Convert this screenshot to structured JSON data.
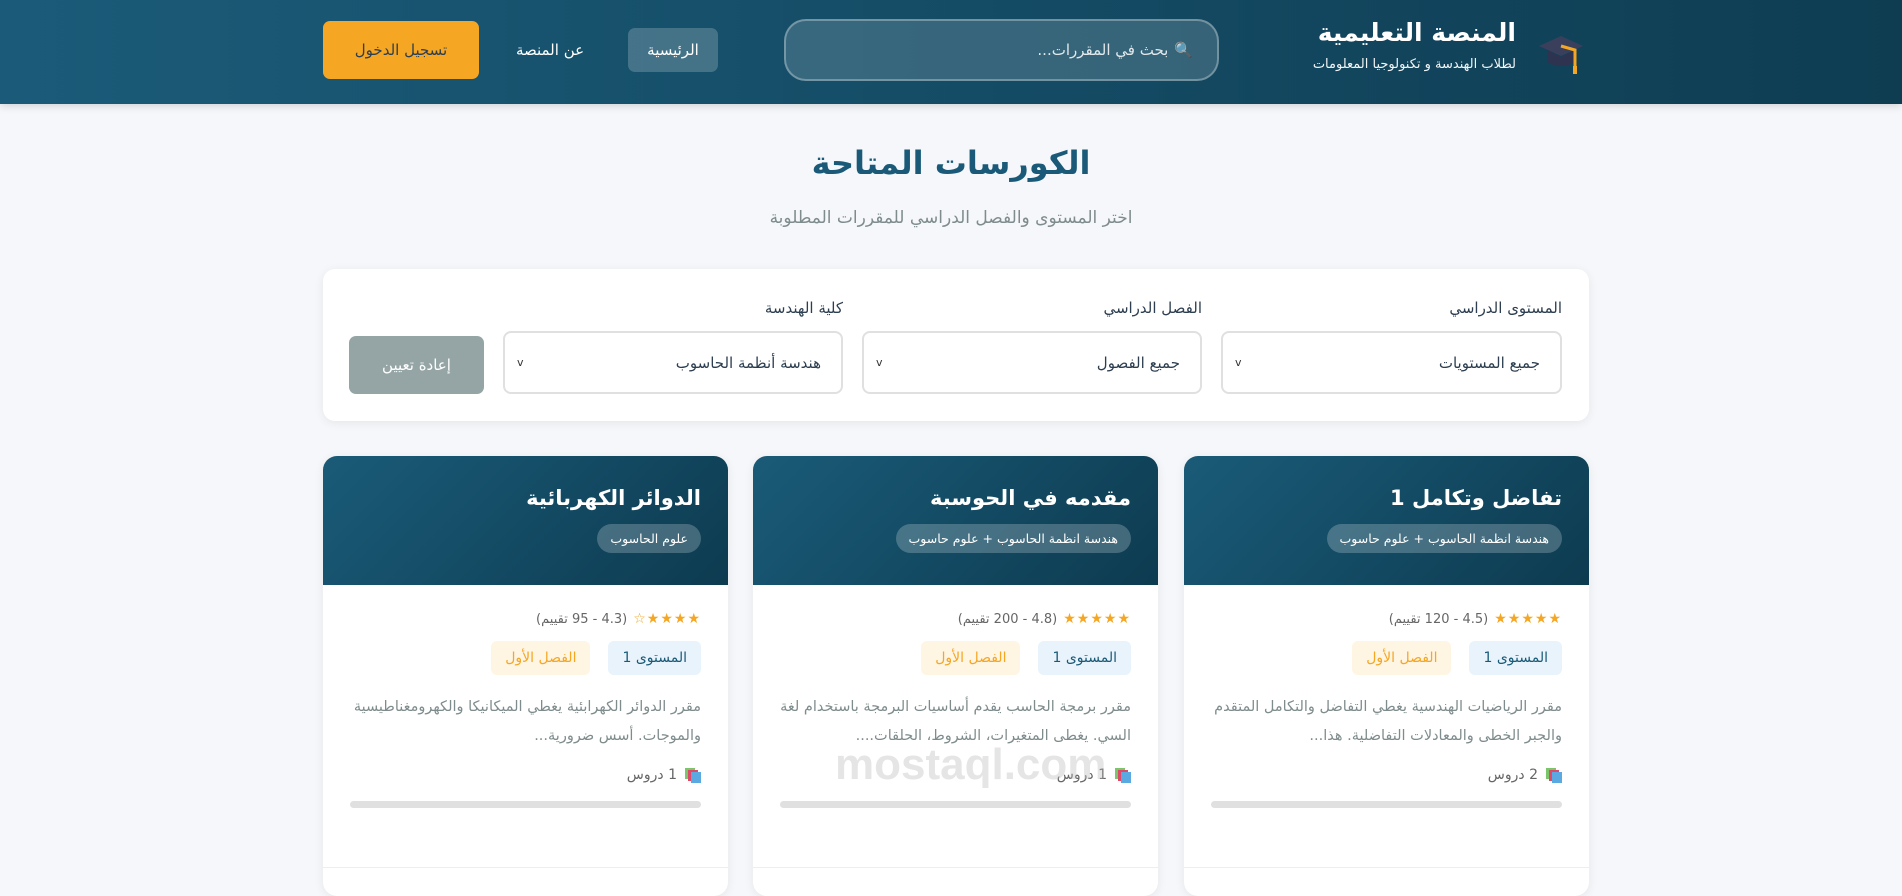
{
  "header": {
    "title": "المنصة التعليمية",
    "subtitle": "لطلاب الهندسة و تكنولوجيا المعلومات",
    "search_placeholder": "بحث في المقررات...",
    "nav": {
      "home": "الرئيسية",
      "about": "عن المنصة",
      "login": "تسجيل الدخول"
    }
  },
  "page": {
    "title": "الكورسات المتاحة",
    "subtitle": "اختر المستوى والفصل الدراسي للمقررات المطلوبة"
  },
  "filters": {
    "level_label": "المستوى الدراسي",
    "level_value": "جميع المستويات",
    "semester_label": "الفصل الدراسي",
    "semester_value": "جميع الفصول",
    "college_label": "كلية الهندسة",
    "college_value": "هندسة أنظمة الحاسوب",
    "reset": "إعادة تعيين"
  },
  "courses": [
    {
      "title": "تفاضل وتكامل 1",
      "tag": "هندسة انظمة الحاسوب + علوم حاسوب",
      "stars": "★★★★★",
      "rating": "(4.5 - 120 تقييم)",
      "level": "المستوى 1",
      "semester": "الفصل الأول",
      "description": "مقرر الرياضيات الهندسية يغطي التفاضل والتكامل المتقدم والجبر الخطى والمعادلات التفاضلية. هذا...",
      "lessons": "2 دروس",
      "progress": 0
    },
    {
      "title": "مقدمه في الحوسبة",
      "tag": "هندسة انظمة الحاسوب + علوم حاسوب",
      "stars": "★★★★★",
      "rating": "(4.8 - 200 تقييم)",
      "level": "المستوى 1",
      "semester": "الفصل الأول",
      "description": "مقرر برمجة الحاسب يقدم أساسيات البرمجة باستخدام لغة السي. يغطى المتغيرات، الشروط، الحلقات....",
      "lessons": "1 دروس",
      "progress": 0
    },
    {
      "title": "الدوائر الكهربائية",
      "tag": "علوم الحاسوب",
      "stars": "★★★★☆",
      "rating": "(4.3 - 95 تقييم)",
      "level": "المستوى 1",
      "semester": "الفصل الأول",
      "description": "مقرر الدوائر الكهرابئية يغطي الميكانيكا والكهرومغناطيسية والموجات. أسس ضرورية...",
      "lessons": "1 دروس",
      "progress": 0
    }
  ],
  "watermark": "mostaql.com"
}
